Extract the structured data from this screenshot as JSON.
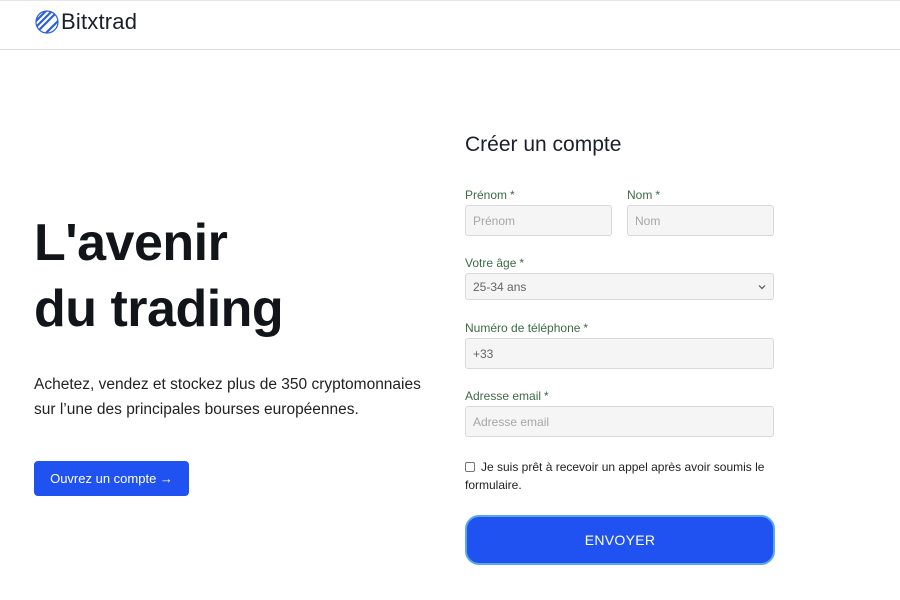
{
  "header": {
    "brand": "Bitxtrad",
    "logo_icon": "striped-globe-icon",
    "brand_color": "#2b5fd9"
  },
  "hero": {
    "title_line1": "L'avenir",
    "title_line2": "du trading",
    "subtitle": "Achetez, vendez et stockez plus de 350 cryptomonnaies sur l’une des principales bourses européennes.",
    "cta_label": "Ouvrez un compte →"
  },
  "form": {
    "title": "Créer un compte",
    "required_mark": "*",
    "first_name": {
      "label": "Prénom",
      "placeholder": "Prénom",
      "value": ""
    },
    "last_name": {
      "label": "Nom",
      "placeholder": "Nom",
      "value": ""
    },
    "age": {
      "label": "Votre âge",
      "selected": "25-34 ans",
      "icon": "chevron-down-icon"
    },
    "phone": {
      "label": "Numéro de téléphone",
      "value": "+33"
    },
    "email": {
      "label": "Adresse email",
      "placeholder": "Adresse email",
      "value": ""
    },
    "consent": {
      "checked": false,
      "label": "Je suis prêt à recevoir un appel après avoir soumis le formulaire."
    },
    "submit_label": "ENVOYER"
  },
  "colors": {
    "accent": "#1f52f0",
    "label_green": "#3d6b45",
    "submit_border": "#58a8e8"
  }
}
